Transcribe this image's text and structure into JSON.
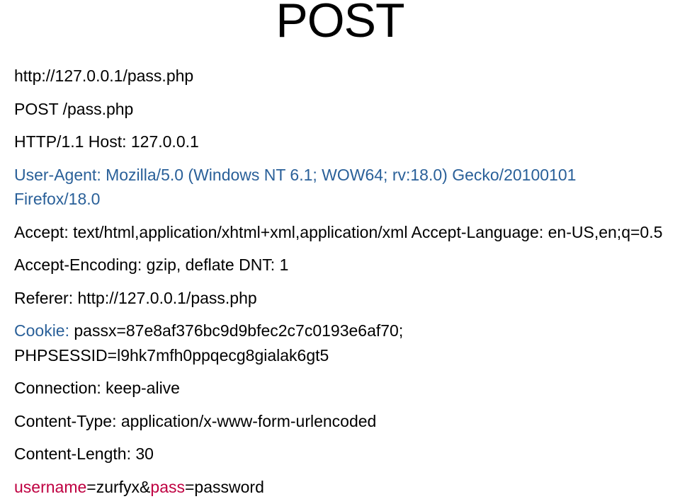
{
  "title": "POST",
  "lines": {
    "url": "http://127.0.0.1/pass.php",
    "request_line": "POST /pass.php",
    "http_host": "HTTP/1.1 Host: 127.0.0.1",
    "user_agent": "User-Agent: Mozilla/5.0 (Windows NT 6.1; WOW64; rv:18.0) Gecko/20100101 Firefox/18.0",
    "accept": "Accept: text/html,application/xhtml+xml,application/xml Accept-Language: en-US,en;q=0.5",
    "accept_encoding": "Accept-Encoding: gzip, deflate DNT: 1",
    "referer": "Referer: http://127.0.0.1/pass.php",
    "cookie_label": "Cookie:",
    "cookie_value": " passx=87e8af376bc9d9bfec2c7c0193e6af70; PHPSESSID=l9hk7mfh0ppqecg8gialak6gt5",
    "connection": "Connection: keep-alive",
    "content_type": "Content-Type: application/x-www-form-urlencoded",
    "content_length": "Content-Length: 30",
    "body_user_key": "username",
    "body_user_val": "=zurfyx&",
    "body_pass_key": "pass",
    "body_pass_val": "=password"
  }
}
